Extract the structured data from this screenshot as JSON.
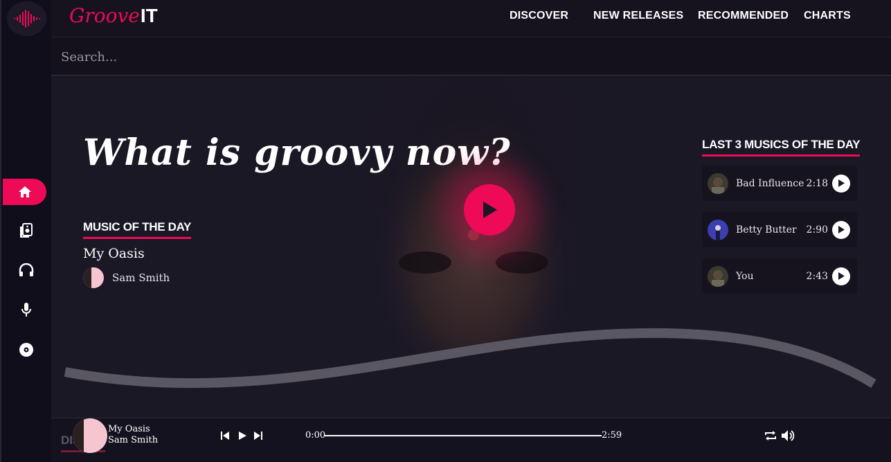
{
  "brand": {
    "script": "Groove",
    "suffix": "IT"
  },
  "nav": [
    "DISCOVER",
    "NEW RELEASES",
    "RECOMMENDED",
    "CHARTS"
  ],
  "search": {
    "placeholder": "Search..."
  },
  "hero": {
    "headline": "What is groovy now?",
    "music_of_day": {
      "section": "MUSIC OF THE DAY",
      "title": "My Oasis",
      "artist": "Sam Smith"
    },
    "last3": {
      "section": "LAST 3 MUSICS OF THE DAY",
      "tracks": [
        {
          "name": "Bad Influence",
          "duration": "2:18"
        },
        {
          "name": "Betty Butter",
          "duration": "2:90"
        },
        {
          "name": "You",
          "duration": "2:43"
        }
      ]
    }
  },
  "player": {
    "side_label": "DIS",
    "title": "My Oasis",
    "artist": "Sam Smith",
    "current_time": "0:00",
    "total_time": "2:59"
  },
  "colors": {
    "accent": "#ee0a56",
    "background": "#15121f"
  }
}
